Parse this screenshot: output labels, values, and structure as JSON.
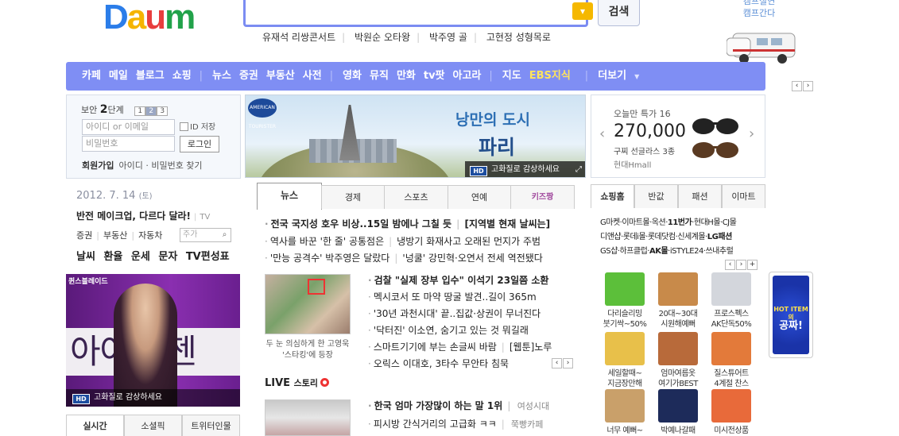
{
  "logo": {
    "text": "Daum"
  },
  "search": {
    "value": "",
    "button": "검색"
  },
  "hot_keywords": [
    "유재석 리쌍콘서트",
    "박원순 오타왕",
    "박주영 골",
    "고현정 성형목로"
  ],
  "camp_ad": {
    "line1": "캠프실연",
    "line2": "캠프간다"
  },
  "gnb": {
    "group1": [
      "카페",
      "메일",
      "블로그",
      "쇼핑"
    ],
    "group2": [
      "뉴스",
      "증권",
      "부동산",
      "사전"
    ],
    "group3": [
      "영화",
      "뮤직",
      "만화",
      "tv팟",
      "아고라"
    ],
    "group4": [
      "지도",
      "EBS지식"
    ],
    "more": "더보기"
  },
  "login": {
    "security_prefix": "보안",
    "security_level": "2",
    "security_suffix": "단계",
    "levels": [
      "1",
      "2",
      "3"
    ],
    "id_placeholder": "아이디 or 이메일",
    "pw_placeholder": "비밀번호",
    "id_save": "ID 저장",
    "login_button": "로그인",
    "join": "회원가입",
    "find": "아이디 · 비밀번호 찾기"
  },
  "date": {
    "text": "2012. 7. 14",
    "weekday": "(토)"
  },
  "left_headline": {
    "text": "반전 메이크업, 다르다 달라!",
    "tag": "TV"
  },
  "stock_links": [
    "증권",
    "부동산",
    "자동차"
  ],
  "stock_input_placeholder": "주가",
  "quick_links": [
    "날씨",
    "환율",
    "운세",
    "문자",
    "TV편성표"
  ],
  "left_banner": {
    "brand": "퀸스블레이드",
    "big_text": "아이 샹젠",
    "hd_text": "고화질로 감상하세요",
    "hd": "HD"
  },
  "left_tabs": [
    "실시간",
    "소셜픽",
    "트위터인물"
  ],
  "center_banner": {
    "title1": "낭만의 도시",
    "title2": "파리",
    "hd_text": "고화질로 감상하세요",
    "hd": "HD",
    "logo": "AMERICAN TOURISTER"
  },
  "deal": {
    "label": "오늘만 특가",
    "count": "16",
    "price": "270,000",
    "name": "구찌 선글라스 3종",
    "shop": "현대Hmall"
  },
  "news_tabs": [
    "뉴스",
    "경제",
    "스포츠",
    "연예",
    "키즈짱"
  ],
  "news_top": [
    {
      "text": "전국 국지성 호우 비상..15일 밤에나 그칠 듯",
      "extra": "[지역별 현재 날씨는]"
    },
    {
      "text": "역사를 바꾼 '한 줄' 공통점은",
      "extra": "냉방기 화재사고 오래된 먼지가 주범"
    },
    {
      "text": "'만능 공격수' 박주영은 달랐다",
      "extra": "'넝쿨' 강민혁·오연서 전세 역전됐다"
    }
  ],
  "news_photo_caption": "두 눈 의심하게 한 고영욱 '스타킹'에 등장",
  "news_list": [
    {
      "text": "검찰 \"실제 장부 입수\" 이석기 23일쯤 소환",
      "bold": true
    },
    {
      "text": "멕시코서 또 마약 땅굴 발견..길이 365m"
    },
    {
      "text": "'30년 과천시대' 끝..집값·상권이 무너진다"
    },
    {
      "text": "'닥터진' 이소연, 숨기고 있는 것 뭐길래"
    },
    {
      "text": "스마트기기에 부는 손글씨 바람",
      "extra": "[웹툰]노루"
    },
    {
      "text": "오릭스 이대호, 3타수 무안타 침묵"
    }
  ],
  "live": {
    "label": "LIVE",
    "label2": "스토리"
  },
  "live_list": [
    {
      "text": "한국 엄마 가장많이 하는 말 1위",
      "tag": "여성시대",
      "bold": true
    },
    {
      "text": "피시방 간식거리의 고급화 ㅋㅋ",
      "tag": "쭉빵카페"
    }
  ],
  "shop_tabs": [
    "쇼핑홈",
    "반값",
    "패션",
    "이마트"
  ],
  "shop_text": [
    {
      "parts": [
        "G마켓·이마트몰·옥션·",
        "11번가",
        "·현대H몰·CJ몰"
      ]
    },
    {
      "parts": [
        "디앤샵·롯데i몰·롯데닷컴·신세계몰·",
        "LG패션",
        ""
      ]
    },
    {
      "parts": [
        "GS샵·하프클럽·",
        "AK몰",
        "·iSTYLE24·쓰내추럴"
      ]
    }
  ],
  "products": [
    {
      "line1": "다리슬리밍",
      "line2": "붓기싹~50%",
      "color": "#5cbf3a"
    },
    {
      "line1": "20대~30대",
      "line2": "시원해예뻐",
      "color": "#c88a4a"
    },
    {
      "line1": "프로스펙스",
      "line2": "AK단독50%",
      "color": "#d3d6dc"
    },
    {
      "line1": "세일할때~",
      "line2": "지금장만해",
      "color": "#e8c04a"
    },
    {
      "line1": "엄마여름옷",
      "line2": "여기가BEST",
      "color": "#b86a3a"
    },
    {
      "line1": "질스튜어트",
      "line2": "4계절 찬스",
      "color": "#e37a3a"
    },
    {
      "line1": "너무 예뻐~",
      "line2": "",
      "color": "#c9a06a"
    },
    {
      "line1": "박예나갈패",
      "line2": "",
      "color": "#1d2b5a"
    },
    {
      "line1": "미시전상품",
      "line2": "",
      "color": "#e86a3a"
    }
  ],
  "hot_item": {
    "line1": "HOT ITEM의",
    "line2": "공짜!"
  }
}
